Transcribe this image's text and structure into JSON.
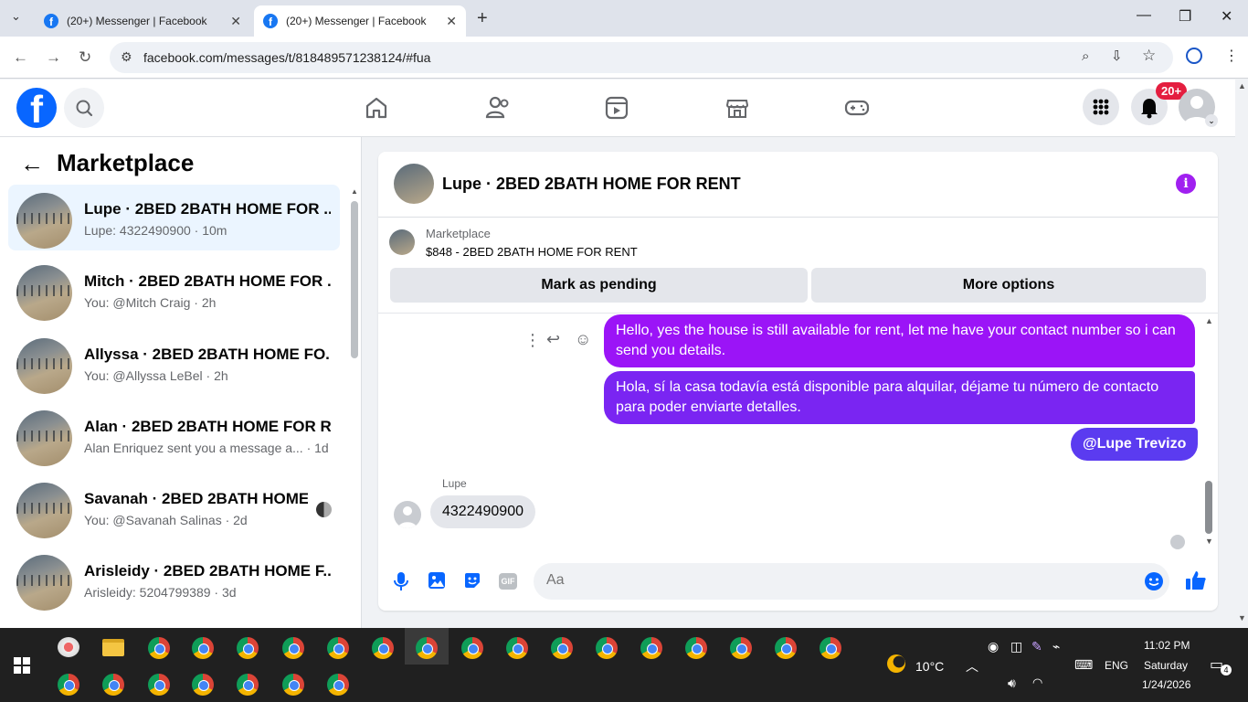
{
  "browser": {
    "tabs": [
      {
        "title": "(20+) Messenger | Facebook"
      },
      {
        "title": "(20+) Messenger | Facebook"
      }
    ],
    "url": "facebook.com/messages/t/818489571238124/#fua"
  },
  "fb": {
    "logo": "f",
    "notifications_badge": "20+",
    "nav_icons": [
      "home-icon",
      "friends-icon",
      "video-icon",
      "marketplace-icon",
      "gaming-icon"
    ]
  },
  "sidebar": {
    "title": "Marketplace",
    "conversations": [
      {
        "title": "Lupe · 2BED 2BATH HOME FOR ...",
        "subtitle": "Lupe: 4322490900 · 10m"
      },
      {
        "title": "Mitch · 2BED 2BATH HOME FOR ...",
        "subtitle": "You: @Mitch Craig · 2h"
      },
      {
        "title": "Allyssa · 2BED 2BATH HOME FO...",
        "subtitle": "You: @Allyssa LeBel · 2h"
      },
      {
        "title": "Alan · 2BED 2BATH HOME FOR R...",
        "subtitle": "Alan Enriquez sent you a message a... · 1d"
      },
      {
        "title": "Savanah · 2BED 2BATH HOME...",
        "subtitle": "You: @Savanah Salinas · 2d"
      },
      {
        "title": "Arisleidy · 2BED 2BATH HOME F...",
        "subtitle": "Arisleidy: 5204799389 · 3d"
      }
    ]
  },
  "chat": {
    "title": "Lupe · 2BED 2BATH HOME FOR RENT",
    "listing_label": "Marketplace",
    "listing_price": "$848 - 2BED 2BATH HOME FOR RENT",
    "mark_pending": "Mark as pending",
    "more_options": "More options",
    "messages_out": [
      "Hello, yes the house is still available for rent, let me have your contact number so i can send you details.",
      "Hola, sí la casa todavía está disponible para alquilar, déjame tu número de contacto para poder enviarte detalles.",
      "@Lupe Trevizo"
    ],
    "sender": "Lupe",
    "message_in": "4322490900",
    "composer_placeholder": "Aa"
  },
  "taskbar": {
    "weather": "10°C",
    "lang": "ENG",
    "time": "11:02 PM",
    "day": "Saturday",
    "date": "1/24/2026",
    "notif_count": "4"
  },
  "colors": {
    "fb_blue": "#0866ff",
    "bubble_purple": "#9b14f7",
    "bubble_violet": "#7a25f2",
    "bubble_indigo": "#5b3bf0"
  }
}
